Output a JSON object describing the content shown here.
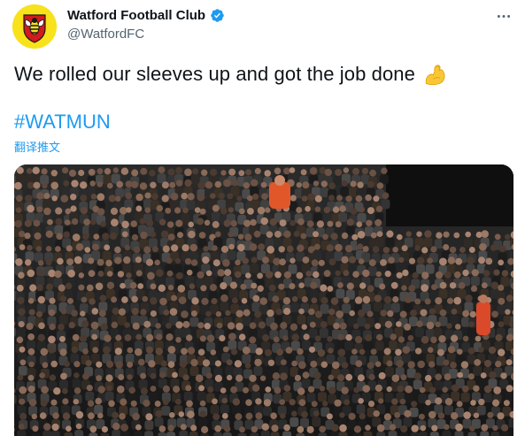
{
  "author": {
    "display_name": "Watford Football Club",
    "handle": "@WatfordFC",
    "avatar_icon": "watford-hornet-crest-icon",
    "verified_icon": "verified-badge-icon",
    "colors": {
      "crest_yellow": "#f7e21c",
      "crest_red": "#d11b1f",
      "verified_blue": "#1d9bf0"
    }
  },
  "menu_icon": "more-horizontal-icon",
  "tweet": {
    "text": "We rolled our sleeves up and got the job done",
    "emoji_icon": "flexed-biceps-icon",
    "hashtag": "#WATMUN",
    "translate_label": "翻译推文"
  },
  "media": {
    "icon": "crowd-photo",
    "colors": {
      "background": "#1a1a1a",
      "accent_orange": "#e2572a"
    }
  },
  "colors": {
    "text_primary": "#0f1419",
    "text_secondary": "#536471",
    "link": "#1d9bf0"
  }
}
